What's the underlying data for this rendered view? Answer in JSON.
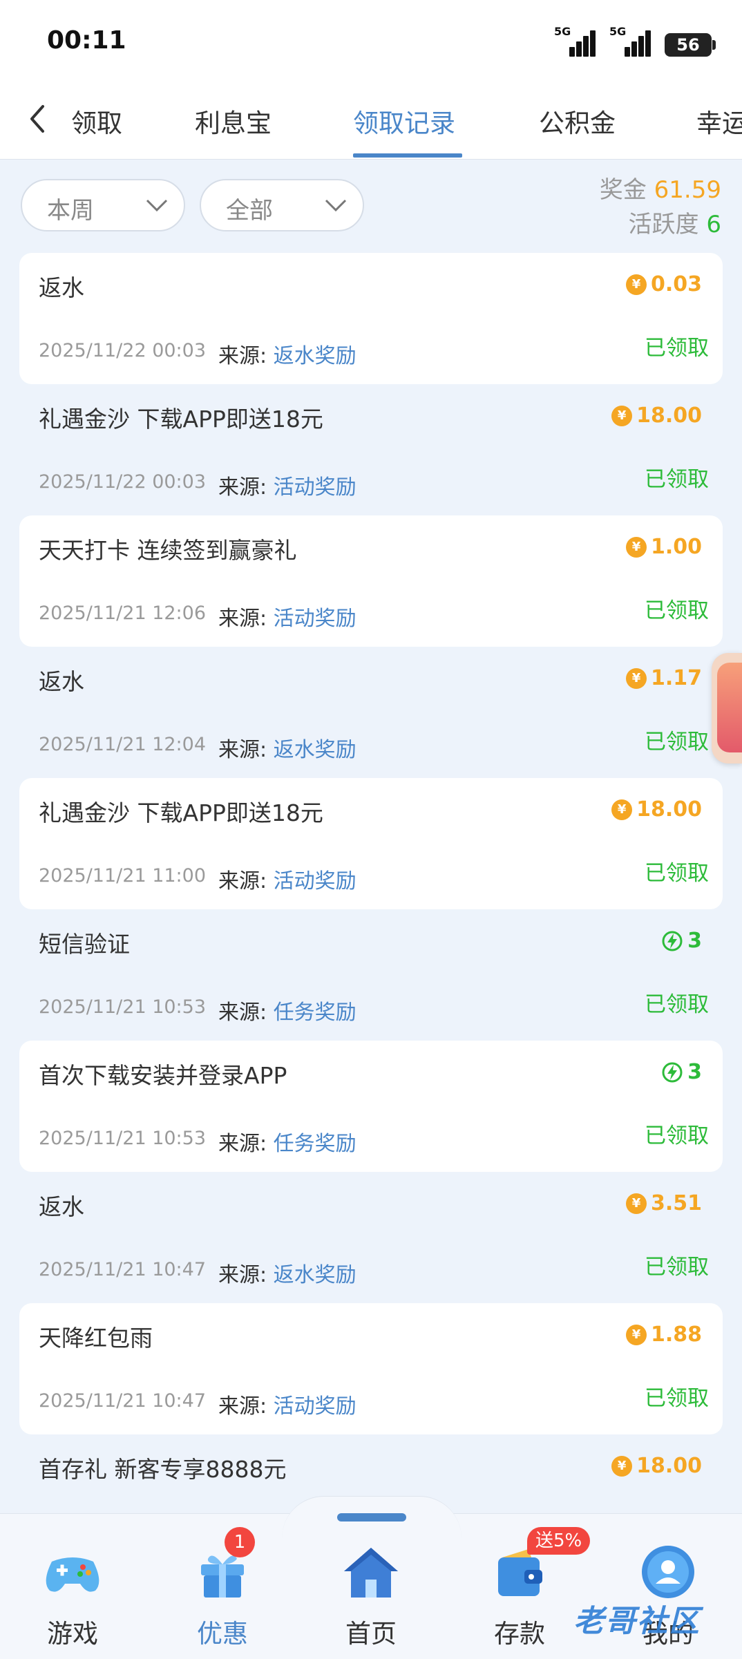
{
  "status": {
    "time": "00:11",
    "signal1": "5G",
    "signal2": "5G",
    "battery": "56"
  },
  "tabs": [
    {
      "label": "领取"
    },
    {
      "label": "利息宝"
    },
    {
      "label": "领取记录"
    },
    {
      "label": "公积金"
    },
    {
      "label": "幸运"
    }
  ],
  "filters": {
    "period": "本周",
    "type": "全部"
  },
  "summary": {
    "bonus_label": "奖金",
    "bonus_value": "61.59",
    "activity_label": "活跃度",
    "activity_value": "6"
  },
  "source_prefix": "来源: ",
  "records": [
    {
      "title": "返水",
      "date": "2025/11/22 00:03",
      "source": "返水奖励",
      "amount": "0.03",
      "kind": "money",
      "status": "已领取"
    },
    {
      "title": "礼遇金沙 下载APP即送18元",
      "date": "2025/11/22 00:03",
      "source": "活动奖励",
      "amount": "18.00",
      "kind": "money",
      "status": "已领取"
    },
    {
      "title": "天天打卡 连续签到赢豪礼",
      "date": "2025/11/21 12:06",
      "source": "活动奖励",
      "amount": "1.00",
      "kind": "money",
      "status": "已领取"
    },
    {
      "title": "返水",
      "date": "2025/11/21 12:04",
      "source": "返水奖励",
      "amount": "1.17",
      "kind": "money",
      "status": "已领取"
    },
    {
      "title": "礼遇金沙 下载APP即送18元",
      "date": "2025/11/21 11:00",
      "source": "活动奖励",
      "amount": "18.00",
      "kind": "money",
      "status": "已领取"
    },
    {
      "title": "短信验证",
      "date": "2025/11/21 10:53",
      "source": "任务奖励",
      "amount": "3",
      "kind": "energy",
      "status": "已领取"
    },
    {
      "title": "首次下载安装并登录APP",
      "date": "2025/11/21 10:53",
      "source": "任务奖励",
      "amount": "3",
      "kind": "energy",
      "status": "已领取"
    },
    {
      "title": "返水",
      "date": "2025/11/21 10:47",
      "source": "返水奖励",
      "amount": "3.51",
      "kind": "money",
      "status": "已领取"
    },
    {
      "title": "天降红包雨",
      "date": "2025/11/21 10:47",
      "source": "活动奖励",
      "amount": "1.88",
      "kind": "money",
      "status": "已领取"
    },
    {
      "title": "首存礼 新客专享8888元",
      "date": "",
      "source": "",
      "amount": "18.00",
      "kind": "money",
      "status": ""
    }
  ],
  "bottom_nav": [
    {
      "label": "游戏",
      "icon": "gamepad-icon"
    },
    {
      "label": "优惠",
      "icon": "gift-icon",
      "badge": "1"
    },
    {
      "label": "首页",
      "icon": "home-icon"
    },
    {
      "label": "存款",
      "icon": "wallet-icon",
      "badge": "送5%"
    },
    {
      "label": "我的",
      "icon": "user-icon"
    }
  ],
  "watermark": "老哥社区",
  "colors": {
    "accent": "#4a86c9",
    "gold": "#f5a623",
    "green": "#2dbb3a",
    "badge": "#f2463f",
    "background": "#edf3fb"
  }
}
